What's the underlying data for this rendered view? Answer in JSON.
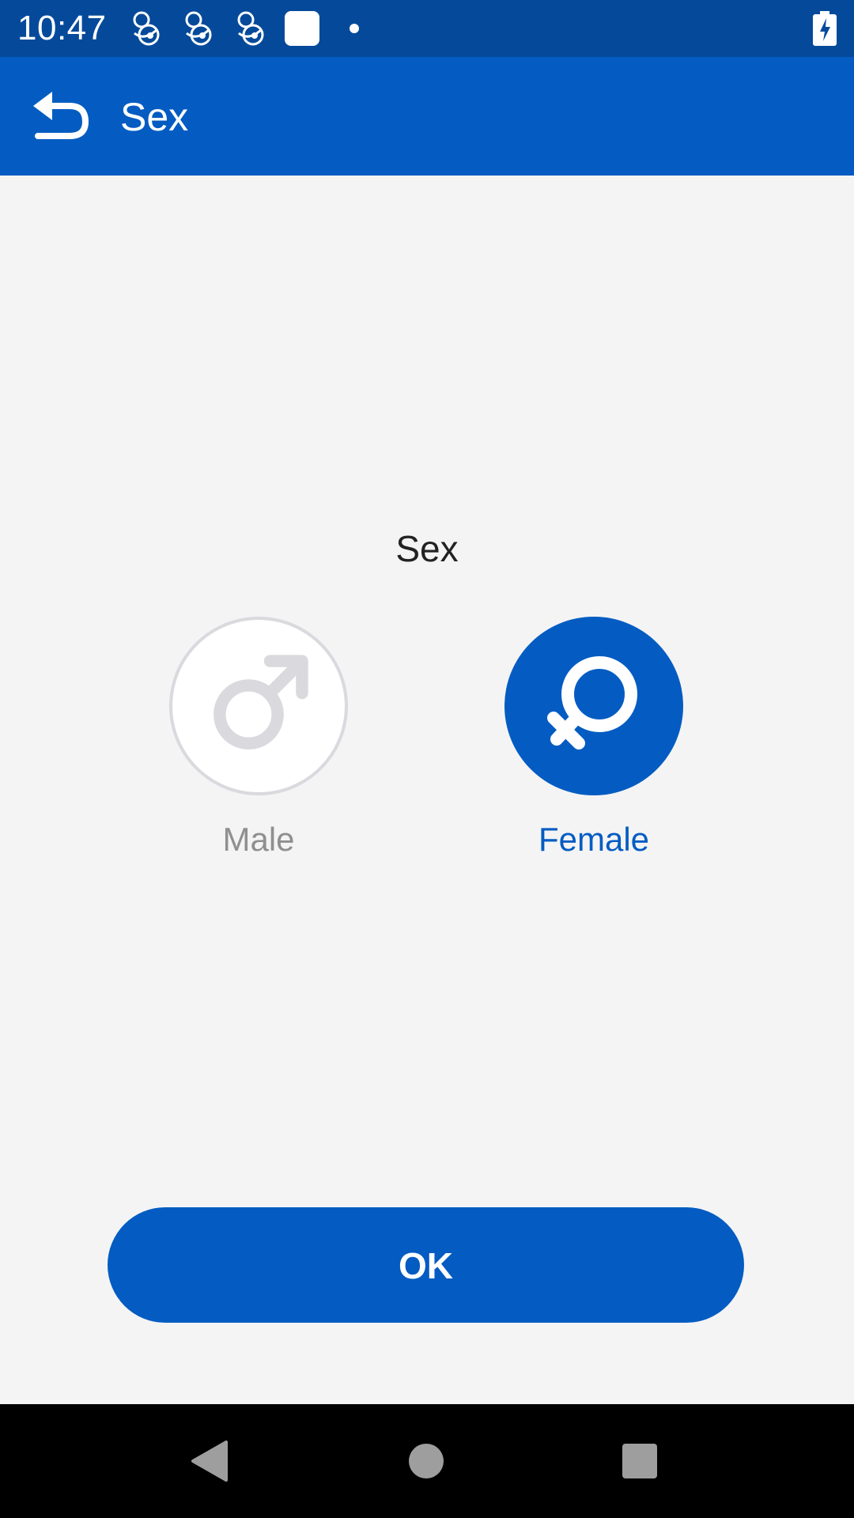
{
  "status_bar": {
    "time": "10:47",
    "notification_icons": [
      "baby-feeding-icon",
      "baby-feeding-icon",
      "baby-feeding-icon",
      "white-square-icon",
      "dot-icon"
    ],
    "battery_icon": "battery-charging-icon",
    "background_color": "#054a9a"
  },
  "app_bar": {
    "title": "Sex",
    "back_icon": "back-arrow-icon",
    "background_color": "#045cc2"
  },
  "main": {
    "heading": "Sex",
    "options": [
      {
        "label": "Male",
        "icon": "male-symbol-icon",
        "selected": false
      },
      {
        "label": "Female",
        "icon": "female-symbol-icon",
        "selected": true
      }
    ],
    "ok_label": "OK",
    "accent_color": "#045cc2"
  },
  "nav_bar": {
    "icons": [
      "nav-back-icon",
      "nav-home-icon",
      "nav-recents-icon"
    ]
  }
}
